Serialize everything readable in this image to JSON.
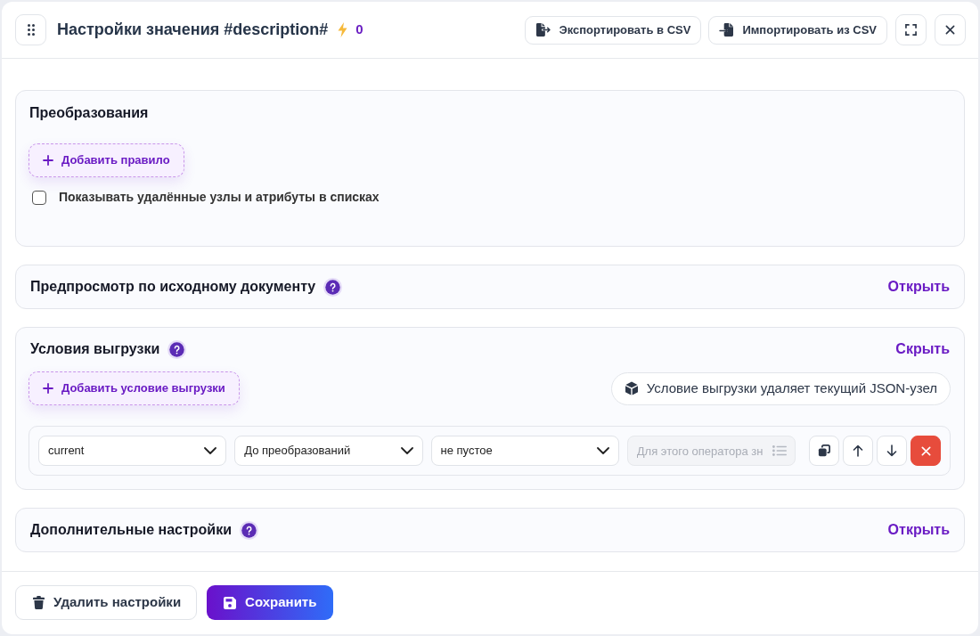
{
  "header": {
    "title": "Настройки значения #description#",
    "counter": "0",
    "buttons": [
      {
        "kind": "export",
        "label": "Экспортировать в CSV"
      },
      {
        "kind": "import",
        "label": "Импортировать из CSV"
      }
    ]
  },
  "sections": [
    {
      "kind": "rules",
      "title": "Преобразования",
      "add_button": "Добавить правило",
      "checkbox": {
        "label": "Показывать удалённые узлы и атрибуты в списках",
        "checked": false
      }
    },
    {
      "kind": "panel",
      "title": "Предпросмотр по исходному документу",
      "help": true,
      "toggle": "Открыть",
      "expanded": false
    },
    {
      "kind": "panel",
      "title": "Условия выгрузки",
      "help": true,
      "toggle": "Скрыть",
      "expanded": true,
      "add_button": "Добавить условие выгрузки",
      "notice": "Условие выгрузки удаляет текущий JSON-узел",
      "conditions": [
        {
          "field": "current",
          "stage": "До преобразований",
          "operator": "не пустое",
          "placeholder": "Для этого оператора зн",
          "disabled": true
        }
      ]
    },
    {
      "kind": "panel",
      "title": "Дополнительные настройки",
      "help": true,
      "toggle": "Открыть",
      "expanded": false
    }
  ],
  "footer": {
    "buttons": [
      {
        "kind": "delete",
        "label": "Удалить настройки"
      },
      {
        "kind": "save",
        "label": "Сохранить"
      }
    ]
  }
}
